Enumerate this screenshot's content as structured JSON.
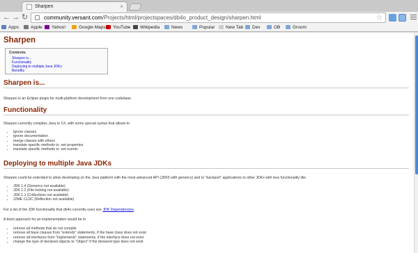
{
  "browser": {
    "tab_title": "Sharpen",
    "tab_close": "×",
    "url_host": "community.versant.com",
    "url_path": "/Projects/html/projectspaces/db4o_product_design/sharpen.html",
    "back_glyph": "←",
    "forward_glyph": "→",
    "reload_glyph": "↻",
    "star_glyph": "☆"
  },
  "bookmarks": [
    {
      "label": "Apps",
      "icon": "apps-grid-icon",
      "color": "#5a7fc2"
    },
    {
      "label": "Apple",
      "icon": "apple-icon",
      "color": "#777777"
    },
    {
      "label": "Yahoo!",
      "icon": "yahoo-icon",
      "color": "#7b0099"
    },
    {
      "label": "Google Maps",
      "icon": "google-maps-icon",
      "color": "#e8a317"
    },
    {
      "label": "YouTube",
      "icon": "youtube-icon",
      "color": "#cc0000"
    },
    {
      "label": "Wikipedia",
      "icon": "wikipedia-icon",
      "color": "#444444"
    },
    {
      "label": "News",
      "icon": "folder-icon",
      "color": "#7fa6d8"
    },
    {
      "label": "Popular",
      "icon": "folder-icon",
      "color": "#7fa6d8"
    },
    {
      "label": "New Tab",
      "icon": "page-icon",
      "color": "#cccccc"
    },
    {
      "label": "Dev",
      "icon": "folder-icon",
      "color": "#7fa6d8"
    },
    {
      "label": "OB",
      "icon": "folder-icon",
      "color": "#7fa6d8"
    },
    {
      "label": "Groom",
      "icon": "folder-icon",
      "color": "#7fa6d8"
    }
  ],
  "page": {
    "title": "Sharpen",
    "toc": {
      "heading": "Contents",
      "items": [
        "Sharpen is...",
        "Functionality",
        "Deploying to multiple Java JDKs",
        "Benefits"
      ]
    },
    "s1": {
      "heading": "Sharpen is...",
      "text": "Sharpen is an Eclipse plugin for multi-platform development from one codebase."
    },
    "s2": {
      "heading": "Functionality",
      "intro": "Sharpen currently compiles Java to C#, with some special syntax that allows to",
      "items": [
        "ignore classes",
        "ignore documentation",
        "merge classes with others",
        "translate specific methods to .net properties",
        "translate specific methods to .net events"
      ]
    },
    "s3": {
      "heading": "Deploying to multiple Java JDKs",
      "intro": "Sharpen could be extended to allow developing on the Java platform with the most advanced API (JDK5 with generics) and to \"backport\" applications to other JDKs with less functionality like",
      "jdks": [
        "JDK 1.4 (Generics not available)",
        "JDK 1.2 (File locking not available)",
        "JDK 1.1 (Collections not available)",
        "J2ME CLDC (Reflection not available)"
      ],
      "deps_prefix": "For a list of the JDK functionality that db4o currently uses see",
      "deps_link": "JDK Dependencies",
      "deps_suffix": ".",
      "blunt": "A blunt approach for an implementation would be to",
      "steps": [
        "remove all methods that do not compile",
        "remove all base classes from \"extends\" statements, if the base class does not exist",
        "remove all interfaces from \"implements\" statements, if the interface does not exist",
        "change the type of declared objects to \"Object\" if the declared type does not exist"
      ]
    }
  },
  "colors": {
    "heading": "#8b2500",
    "link": "#0b0bd8",
    "scroll_thumb": "#4c88d6"
  }
}
